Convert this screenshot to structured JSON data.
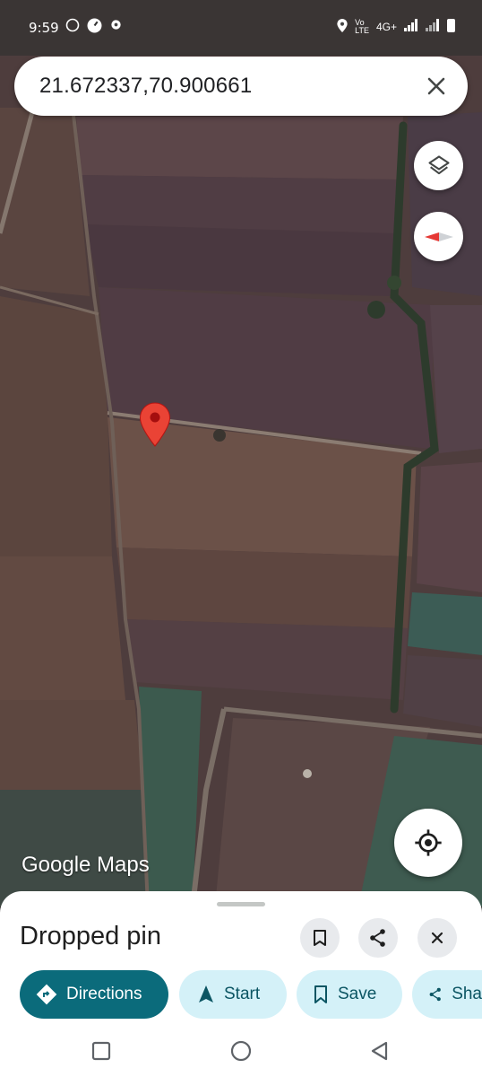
{
  "status_bar": {
    "time": "9:59",
    "network": "4G+"
  },
  "search": {
    "query": "21.672337,70.900661"
  },
  "map": {
    "attribution": "Google Maps"
  },
  "sheet": {
    "title": "Dropped pin",
    "actions": [
      {
        "label": "Directions"
      },
      {
        "label": "Start"
      },
      {
        "label": "Save"
      },
      {
        "label": "Sha"
      }
    ]
  },
  "colors": {
    "accent": "#0b6b7b",
    "chip": "#d4f1f8",
    "pin": "#ea4335"
  }
}
